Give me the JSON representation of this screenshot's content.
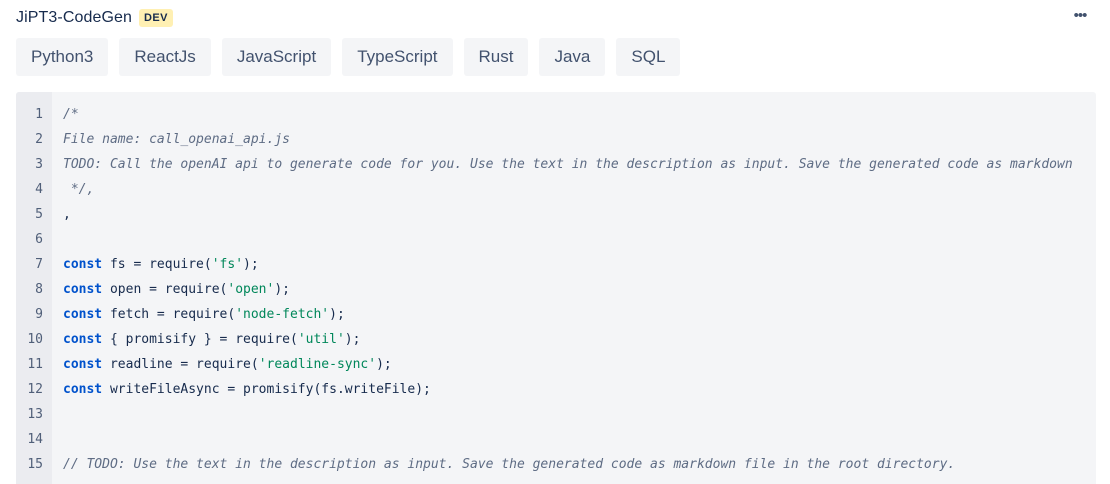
{
  "header": {
    "title": "JiPT3-CodeGen",
    "badge": "DEV",
    "more_label": "•••"
  },
  "tabs": [
    {
      "label": "Python3"
    },
    {
      "label": "ReactJs"
    },
    {
      "label": "JavaScript"
    },
    {
      "label": "TypeScript"
    },
    {
      "label": "Rust"
    },
    {
      "label": "Java"
    },
    {
      "label": "SQL"
    }
  ],
  "code": {
    "lines": [
      {
        "n": "1",
        "tokens": [
          {
            "t": "comment",
            "v": "/*"
          }
        ]
      },
      {
        "n": "2",
        "tokens": [
          {
            "t": "comment",
            "v": "File name: call_openai_api.js"
          }
        ]
      },
      {
        "n": "3",
        "tokens": [
          {
            "t": "comment",
            "v": "TODO: Call the openAI api to generate code for you. Use the text in the description as input. Save the generated code as markdown"
          }
        ]
      },
      {
        "n": "4",
        "tokens": [
          {
            "t": "comment",
            "v": " */,"
          }
        ]
      },
      {
        "n": "5",
        "tokens": [
          {
            "t": "plain",
            "v": ","
          }
        ]
      },
      {
        "n": "6",
        "tokens": []
      },
      {
        "n": "7",
        "tokens": [
          {
            "t": "keyword",
            "v": "const"
          },
          {
            "t": "plain",
            "v": " fs = require("
          },
          {
            "t": "string",
            "v": "'fs'"
          },
          {
            "t": "plain",
            "v": ");"
          }
        ]
      },
      {
        "n": "8",
        "tokens": [
          {
            "t": "keyword",
            "v": "const"
          },
          {
            "t": "plain",
            "v": " open = require("
          },
          {
            "t": "string",
            "v": "'open'"
          },
          {
            "t": "plain",
            "v": ");"
          }
        ]
      },
      {
        "n": "9",
        "tokens": [
          {
            "t": "keyword",
            "v": "const"
          },
          {
            "t": "plain",
            "v": " fetch = require("
          },
          {
            "t": "string",
            "v": "'node-fetch'"
          },
          {
            "t": "plain",
            "v": ");"
          }
        ]
      },
      {
        "n": "10",
        "tokens": [
          {
            "t": "keyword",
            "v": "const"
          },
          {
            "t": "plain",
            "v": " { promisify } = require("
          },
          {
            "t": "string",
            "v": "'util'"
          },
          {
            "t": "plain",
            "v": ");"
          }
        ]
      },
      {
        "n": "11",
        "tokens": [
          {
            "t": "keyword",
            "v": "const"
          },
          {
            "t": "plain",
            "v": " readline = require("
          },
          {
            "t": "string",
            "v": "'readline-sync'"
          },
          {
            "t": "plain",
            "v": ");"
          }
        ]
      },
      {
        "n": "12",
        "tokens": [
          {
            "t": "keyword",
            "v": "const"
          },
          {
            "t": "plain",
            "v": " writeFileAsync = promisify(fs.writeFile);"
          }
        ]
      },
      {
        "n": "13",
        "tokens": []
      },
      {
        "n": "14",
        "tokens": []
      },
      {
        "n": "15",
        "tokens": [
          {
            "t": "comment",
            "v": "// TODO: Use the text in the description as input. Save the generated code as markdown file in the root directory."
          }
        ]
      }
    ]
  }
}
